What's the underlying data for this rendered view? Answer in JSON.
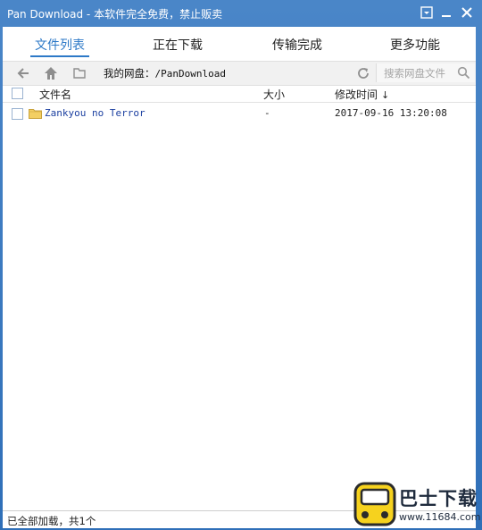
{
  "window": {
    "title": "Pan Download - 本软件完全免费，禁止贩卖"
  },
  "tabs": [
    {
      "label": "文件列表",
      "active": true
    },
    {
      "label": "正在下载",
      "active": false
    },
    {
      "label": "传输完成",
      "active": false
    },
    {
      "label": "更多功能",
      "active": false
    }
  ],
  "toolbar": {
    "path_label": "我的网盘：",
    "path_value": "/PanDownload",
    "search_placeholder": "搜索网盘文件"
  },
  "table": {
    "columns": [
      "文件名",
      "大小",
      "修改时间"
    ],
    "sort_indicator": "↓",
    "rows": [
      {
        "name": "Zankyou no Terror",
        "size": "-",
        "modified": "2017-09-16 13:20:08",
        "type": "folder"
      }
    ]
  },
  "status": {
    "text": "已全部加载，共1个"
  },
  "watermark": {
    "title": "巴士下载",
    "url": "www.11684.com"
  },
  "colors": {
    "accent": "#2d79c7",
    "titlebar": "#3a78c0",
    "link": "#1b3fa0"
  }
}
